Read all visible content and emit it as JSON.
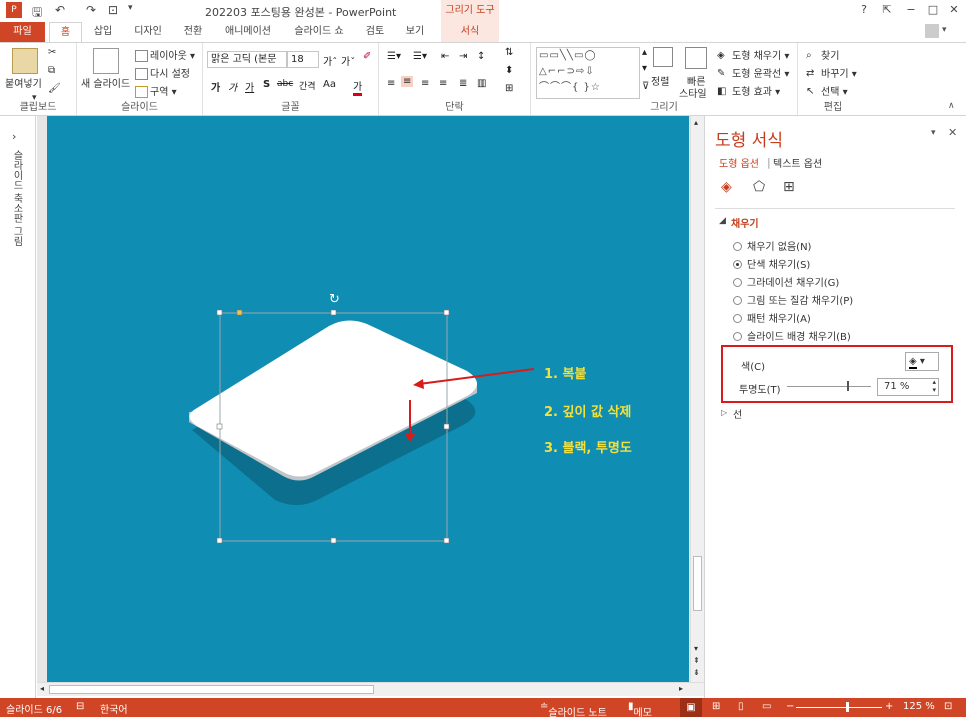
{
  "titlebar": {
    "title": "202203 포스팅용 완성본 - PowerPoint",
    "context_tab": "그리기 도구",
    "help": "?",
    "minimize": "−",
    "restore": "□",
    "close": "✕"
  },
  "tabs": [
    "파일",
    "홈",
    "삽입",
    "디자인",
    "전환",
    "애니메이션",
    "슬라이드 쇼",
    "검토",
    "보기",
    "서식"
  ],
  "ribbon": {
    "clipboard": {
      "label": "클립보드",
      "paste": "붙여넣기"
    },
    "slides": {
      "label": "슬라이드",
      "new_slide": "새 슬라이드",
      "layout": "레이아웃",
      "reset": "다시 설정",
      "section": "구역"
    },
    "font": {
      "label": "글꼴",
      "font_name": "맑은 고딕 (본문",
      "font_size": "18",
      "bold": "가",
      "italic": "가",
      "underline": "가",
      "shadow": "S",
      "strike": "abc",
      "spacing": "간격",
      "case": "Aa",
      "color": "가"
    },
    "paragraph": {
      "label": "단락"
    },
    "drawing": {
      "label": "그리기",
      "arrange": "정렬",
      "quick_styles": "빠른\n스타일",
      "quick1": "빠른",
      "quick2": "스타일",
      "fill": "도형 채우기",
      "outline": "도형 윤곽선",
      "effects": "도형 효과"
    },
    "editing": {
      "label": "편집",
      "find": "찾기",
      "replace": "바꾸기",
      "select": "선택"
    }
  },
  "thumb_strip": {
    "label": "슬라이드 축소판 그림"
  },
  "annotations": [
    "1. 복붙",
    "2. 깊이 값 삭제",
    "3. 블랙, 투명도"
  ],
  "pane": {
    "title": "도형 서식",
    "tab_shape": "도형 옵션",
    "tab_text": "텍스트 옵션",
    "section_fill": "채우기",
    "options": [
      "채우기 없음(N)",
      "단색 채우기(S)",
      "그라데이션 채우기(G)",
      "그림 또는 질감 채우기(P)",
      "패턴 채우기(A)",
      "슬라이드 배경 채우기(B)"
    ],
    "selected_option": "단색 채우기(S)",
    "color_label": "색(C)",
    "transparency_label": "투명도(T)",
    "transparency_value": "71 %",
    "transparency_fraction": 0.71,
    "section_line": "선"
  },
  "status": {
    "slide": "슬라이드 6/6",
    "language": "한국어",
    "notes": "슬라이드 노트",
    "comments": "메모",
    "zoom": "125 %"
  },
  "colors": {
    "accent": "#d04525",
    "slide_bg": "#0f8db2",
    "annotation": "#f5e03a",
    "highlight_box": "#d71c1c"
  }
}
